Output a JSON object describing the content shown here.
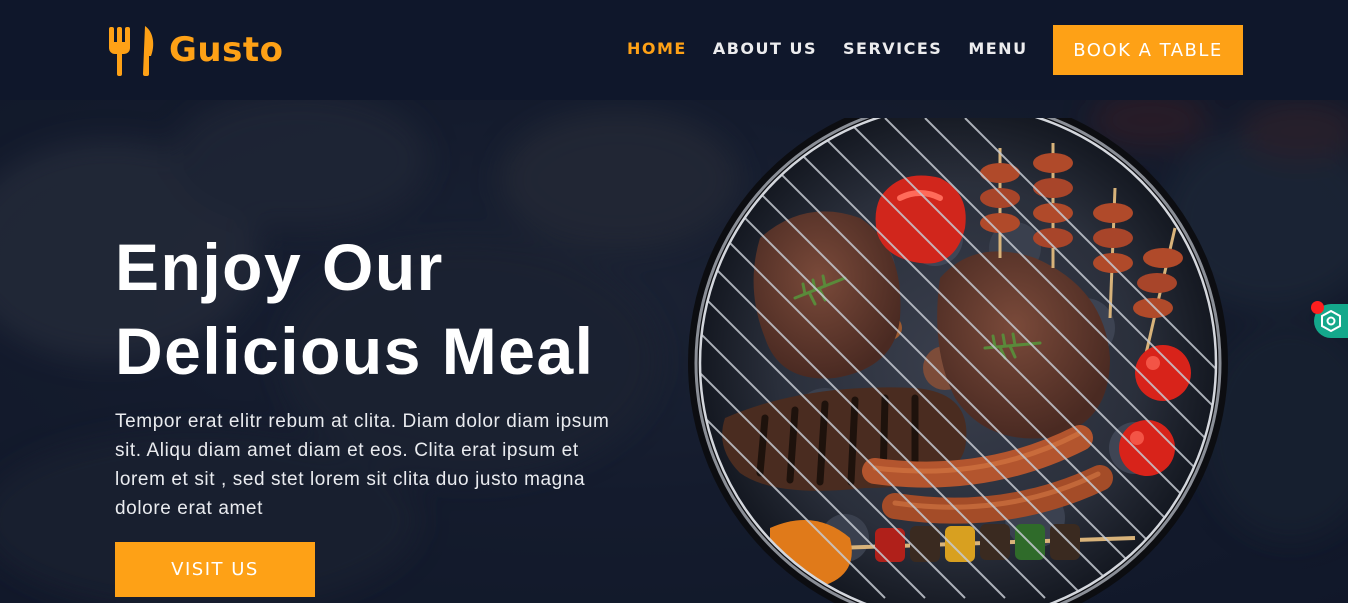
{
  "brand": {
    "name": "Gusto",
    "icon": "utensils-icon"
  },
  "nav": {
    "items": [
      {
        "label": "HOME",
        "active": true
      },
      {
        "label": "ABOUT US",
        "active": false
      },
      {
        "label": "SERVICES",
        "active": false
      },
      {
        "label": "MENU",
        "active": false
      }
    ],
    "cta": "BOOK A TABLE"
  },
  "hero": {
    "title_line1": "Enjoy Our",
    "title_line2": "Delicious Meal",
    "text": "Tempor erat elitr rebum at clita. Diam dolor diam ipsum sit. Aliqu diam amet diam et eos. Clita erat ipsum et lorem et sit , sed stet lorem sit clita duo justo magna dolore erat amet",
    "button": "VISIT US",
    "image": "bbq-grill-image"
  },
  "widget": {
    "icon": "hexagon-settings-icon"
  },
  "colors": {
    "primary": "#fea116",
    "dark": "#0f172b",
    "widget": "#14a88b",
    "notification": "#ff1e1e"
  }
}
